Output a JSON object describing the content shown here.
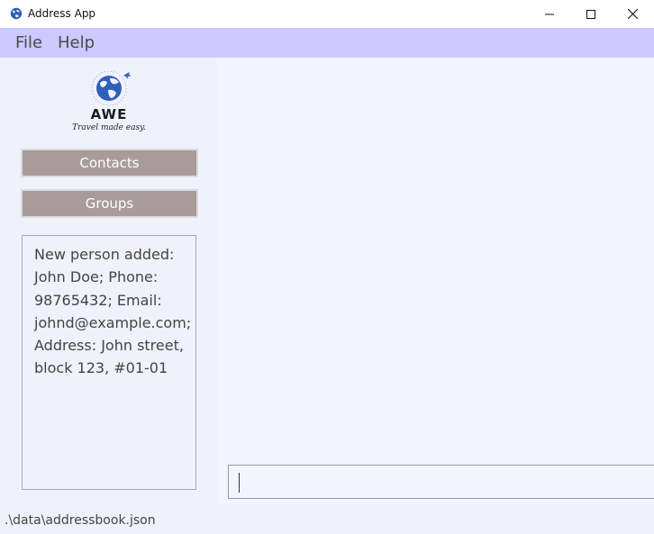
{
  "window": {
    "title": "Address App",
    "icon": "globe-icon"
  },
  "menubar": {
    "file_label": "File",
    "help_label": "Help"
  },
  "sidebar": {
    "logo": {
      "name": "AWE",
      "tagline": "Travel made easy."
    },
    "contacts_label": "Contacts",
    "groups_label": "Groups",
    "result_text": "New person added: John Doe; Phone: 98765432; Email: johnd@example.com; Address: John street, block 123, #01-01"
  },
  "command": {
    "value": ""
  },
  "status": {
    "file_path": ".\\data\\addressbook.json"
  },
  "colors": {
    "menubar": "#cdc8fe",
    "nav_button": "#a89b9c",
    "background": "#f3f4fc"
  }
}
